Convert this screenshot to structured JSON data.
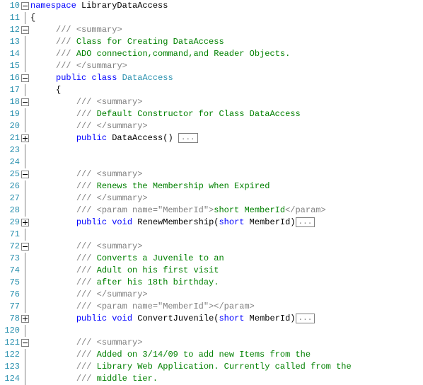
{
  "lines": [
    {
      "num": "10",
      "fold": "minus",
      "seg": [
        {
          "t": "kw",
          "v": "namespace"
        },
        {
          "t": "",
          "v": " LibraryDataAccess"
        }
      ]
    },
    {
      "num": "11",
      "fold": "vline",
      "seg": [
        {
          "t": "",
          "v": "{"
        }
      ]
    },
    {
      "num": "12",
      "fold": "minus",
      "seg": [
        {
          "t": "",
          "v": "     "
        },
        {
          "t": "greytag",
          "v": "/// "
        },
        {
          "t": "greytag",
          "v": "<summary>"
        }
      ]
    },
    {
      "num": "13",
      "fold": "vline",
      "seg": [
        {
          "t": "",
          "v": "     "
        },
        {
          "t": "greytag",
          "v": "///"
        },
        {
          "t": "comment",
          "v": " Class for Creating DataAccess"
        }
      ]
    },
    {
      "num": "14",
      "fold": "vline",
      "seg": [
        {
          "t": "",
          "v": "     "
        },
        {
          "t": "greytag",
          "v": "///"
        },
        {
          "t": "comment",
          "v": " ADO connection,command,and Reader Objects."
        }
      ]
    },
    {
      "num": "15",
      "fold": "vline",
      "seg": [
        {
          "t": "",
          "v": "     "
        },
        {
          "t": "greytag",
          "v": "/// "
        },
        {
          "t": "greytag",
          "v": "</summary>"
        }
      ]
    },
    {
      "num": "16",
      "fold": "minus",
      "seg": [
        {
          "t": "",
          "v": "     "
        },
        {
          "t": "kw",
          "v": "public"
        },
        {
          "t": "",
          "v": " "
        },
        {
          "t": "kw",
          "v": "class"
        },
        {
          "t": "",
          "v": " "
        },
        {
          "t": "type",
          "v": "DataAccess"
        }
      ]
    },
    {
      "num": "17",
      "fold": "vline",
      "seg": [
        {
          "t": "",
          "v": "     {"
        }
      ]
    },
    {
      "num": "18",
      "fold": "minus",
      "seg": [
        {
          "t": "",
          "v": "         "
        },
        {
          "t": "greytag",
          "v": "/// "
        },
        {
          "t": "greytag",
          "v": "<summary>"
        }
      ]
    },
    {
      "num": "19",
      "fold": "vline",
      "seg": [
        {
          "t": "",
          "v": "         "
        },
        {
          "t": "greytag",
          "v": "///"
        },
        {
          "t": "comment",
          "v": " Default Constructor for Class DataAccess"
        }
      ]
    },
    {
      "num": "20",
      "fold": "vline",
      "seg": [
        {
          "t": "",
          "v": "         "
        },
        {
          "t": "greytag",
          "v": "/// "
        },
        {
          "t": "greytag",
          "v": "</summary>"
        }
      ]
    },
    {
      "num": "21",
      "fold": "plus",
      "seg": [
        {
          "t": "",
          "v": "         "
        },
        {
          "t": "kw",
          "v": "public"
        },
        {
          "t": "",
          "v": " DataAccess() "
        }
      ],
      "collapsed": "..."
    },
    {
      "num": "23",
      "fold": "vline",
      "seg": [
        {
          "t": "",
          "v": ""
        }
      ]
    },
    {
      "num": "24",
      "fold": "vline",
      "seg": [
        {
          "t": "",
          "v": ""
        }
      ]
    },
    {
      "num": "25",
      "fold": "minus",
      "seg": [
        {
          "t": "",
          "v": "         "
        },
        {
          "t": "greytag",
          "v": "/// "
        },
        {
          "t": "greytag",
          "v": "<summary>"
        }
      ]
    },
    {
      "num": "26",
      "fold": "vline",
      "seg": [
        {
          "t": "",
          "v": "         "
        },
        {
          "t": "greytag",
          "v": "///"
        },
        {
          "t": "comment",
          "v": " Renews the Membership when Expired"
        }
      ]
    },
    {
      "num": "27",
      "fold": "vline",
      "seg": [
        {
          "t": "",
          "v": "         "
        },
        {
          "t": "greytag",
          "v": "/// "
        },
        {
          "t": "greytag",
          "v": "</summary>"
        }
      ]
    },
    {
      "num": "28",
      "fold": "vline",
      "seg": [
        {
          "t": "",
          "v": "         "
        },
        {
          "t": "greytag",
          "v": "/// <param name=\"MemberId\">"
        },
        {
          "t": "comment",
          "v": "short MemberId"
        },
        {
          "t": "greytag",
          "v": "</param>"
        }
      ]
    },
    {
      "num": "29",
      "fold": "plus",
      "seg": [
        {
          "t": "",
          "v": "         "
        },
        {
          "t": "kw",
          "v": "public"
        },
        {
          "t": "",
          "v": " "
        },
        {
          "t": "kw",
          "v": "void"
        },
        {
          "t": "",
          "v": " RenewMembership("
        },
        {
          "t": "kw",
          "v": "short"
        },
        {
          "t": "",
          "v": " MemberId)"
        }
      ],
      "collapsed": "..."
    },
    {
      "num": "71",
      "fold": "vline",
      "seg": [
        {
          "t": "",
          "v": ""
        }
      ]
    },
    {
      "num": "72",
      "fold": "minus",
      "seg": [
        {
          "t": "",
          "v": "         "
        },
        {
          "t": "greytag",
          "v": "/// "
        },
        {
          "t": "greytag",
          "v": "<summary>"
        }
      ]
    },
    {
      "num": "73",
      "fold": "vline",
      "seg": [
        {
          "t": "",
          "v": "         "
        },
        {
          "t": "greytag",
          "v": "///"
        },
        {
          "t": "comment",
          "v": " Converts a Juvenile to an"
        }
      ]
    },
    {
      "num": "74",
      "fold": "vline",
      "seg": [
        {
          "t": "",
          "v": "         "
        },
        {
          "t": "greytag",
          "v": "///"
        },
        {
          "t": "comment",
          "v": " Adult on his first visit"
        }
      ]
    },
    {
      "num": "75",
      "fold": "vline",
      "seg": [
        {
          "t": "",
          "v": "         "
        },
        {
          "t": "greytag",
          "v": "///"
        },
        {
          "t": "comment",
          "v": " after his 18th birthday."
        }
      ]
    },
    {
      "num": "76",
      "fold": "vline",
      "seg": [
        {
          "t": "",
          "v": "         "
        },
        {
          "t": "greytag",
          "v": "/// "
        },
        {
          "t": "greytag",
          "v": "</summary>"
        }
      ]
    },
    {
      "num": "77",
      "fold": "vline",
      "seg": [
        {
          "t": "",
          "v": "         "
        },
        {
          "t": "greytag",
          "v": "/// <param name=\"MemberId\"></param>"
        }
      ]
    },
    {
      "num": "78",
      "fold": "plus",
      "seg": [
        {
          "t": "",
          "v": "         "
        },
        {
          "t": "kw",
          "v": "public"
        },
        {
          "t": "",
          "v": " "
        },
        {
          "t": "kw",
          "v": "void"
        },
        {
          "t": "",
          "v": " ConvertJuvenile("
        },
        {
          "t": "kw",
          "v": "short"
        },
        {
          "t": "",
          "v": " MemberId)"
        }
      ],
      "collapsed": "..."
    },
    {
      "num": "120",
      "fold": "vline",
      "seg": [
        {
          "t": "",
          "v": ""
        }
      ]
    },
    {
      "num": "121",
      "fold": "minus",
      "seg": [
        {
          "t": "",
          "v": "         "
        },
        {
          "t": "greytag",
          "v": "/// "
        },
        {
          "t": "greytag",
          "v": "<summary>"
        }
      ]
    },
    {
      "num": "122",
      "fold": "vline",
      "seg": [
        {
          "t": "",
          "v": "         "
        },
        {
          "t": "greytag",
          "v": "///"
        },
        {
          "t": "comment",
          "v": " Added on 3/14/09 to add new Items from the"
        }
      ]
    },
    {
      "num": "123",
      "fold": "vline",
      "seg": [
        {
          "t": "",
          "v": "         "
        },
        {
          "t": "greytag",
          "v": "///"
        },
        {
          "t": "comment",
          "v": " Library Web Application. Currently called from the"
        }
      ]
    },
    {
      "num": "124",
      "fold": "vline",
      "seg": [
        {
          "t": "",
          "v": "         "
        },
        {
          "t": "greytag",
          "v": "///"
        },
        {
          "t": "comment",
          "v": " middle tier."
        }
      ]
    }
  ],
  "collapsed_label": "..."
}
